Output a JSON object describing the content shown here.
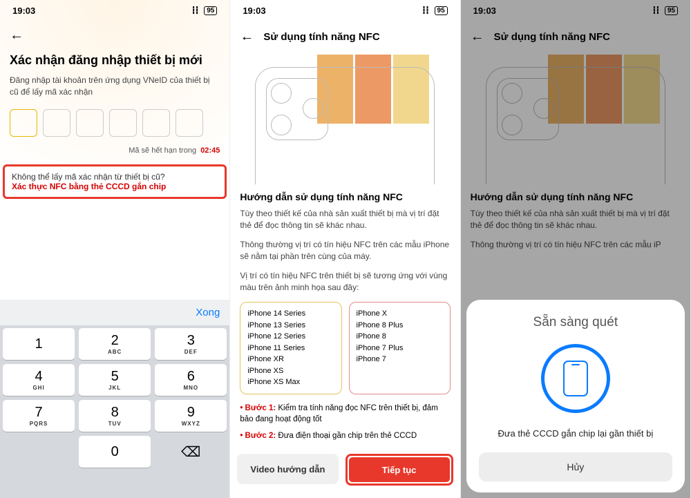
{
  "status": {
    "time": "19:03",
    "battery": "95"
  },
  "s1": {
    "title": "Xác nhận đăng nhập thiết bị mới",
    "subtitle": "Đăng nhập tài khoản trên ứng dụng VNeID của thiết bị cũ để lấy mã xác nhận",
    "expiry_label": "Mã sẽ hết hạn trong",
    "expiry_time": "02:45",
    "nfc_q": "Không thể lấy mã xác nhận từ thiết bị cũ?",
    "nfc_a": "Xác thực NFC bằng thẻ CCCD gắn chip",
    "kbd_done": "Xong",
    "keys": [
      {
        "n": "1",
        "l": ""
      },
      {
        "n": "2",
        "l": "ABC"
      },
      {
        "n": "3",
        "l": "DEF"
      },
      {
        "n": "4",
        "l": "GHI"
      },
      {
        "n": "5",
        "l": "JKL"
      },
      {
        "n": "6",
        "l": "MNO"
      },
      {
        "n": "7",
        "l": "PQRS"
      },
      {
        "n": "8",
        "l": "TUV"
      },
      {
        "n": "9",
        "l": "WXYZ"
      },
      {
        "n": "0",
        "l": ""
      }
    ]
  },
  "s2": {
    "header": "Sử dụng tính năng NFC",
    "guide_title": "Hướng dẫn sử dụng tính năng NFC",
    "p1": "Tùy theo thiết kế của nhà sản xuất thiết bị mà vị trí đặt thẻ để đọc thông tin sẽ khác nhau.",
    "p2": "Thông thường vị trí có tín hiệu NFC trên các mẫu iPhone sẽ nằm tại phần trên cùng của máy.",
    "p3": "Vị trí có tín hiệu NFC trên thiết bị sẽ tương ứng với vùng màu trên ảnh minh họa sau đây:",
    "devices_y": [
      "iPhone 14 Series",
      "iPhone 13 Series",
      "iPhone 12 Series",
      "iPhone 11 Series",
      "iPhone XR",
      "iPhone XS",
      "iPhone XS Max"
    ],
    "devices_r": [
      "iPhone X",
      "iPhone 8 Plus",
      "iPhone 8",
      "iPhone 7 Plus",
      "iPhone 7"
    ],
    "step1_b": "• Bước 1:",
    "step1": " Kiểm tra tính năng đọc NFC trên thiết bị, đảm bảo đang hoạt động tốt",
    "step2_b": "• Bước 2:",
    "step2": " Đưa điện thoại gần chip trên thẻ CCCD",
    "btn_video": "Video hướng dẫn",
    "btn_continue": "Tiếp tục"
  },
  "s3": {
    "header": "Sử dụng tính năng NFC",
    "guide_title": "Hướng dẫn sử dụng tính năng NFC",
    "p1": "Tùy theo thiết kế của nhà sản xuất thiết bị mà vị trí đặt thẻ để đọc thông tin sẽ khác nhau.",
    "p2": "Thông thường vị trí có tín hiệu NFC trên các mẫu iP",
    "scan_title": "Sẵn sàng quét",
    "scan_msg": "Đưa thẻ CCCD gắn chip lại gần thiết bị",
    "btn_cancel": "Hủy"
  }
}
